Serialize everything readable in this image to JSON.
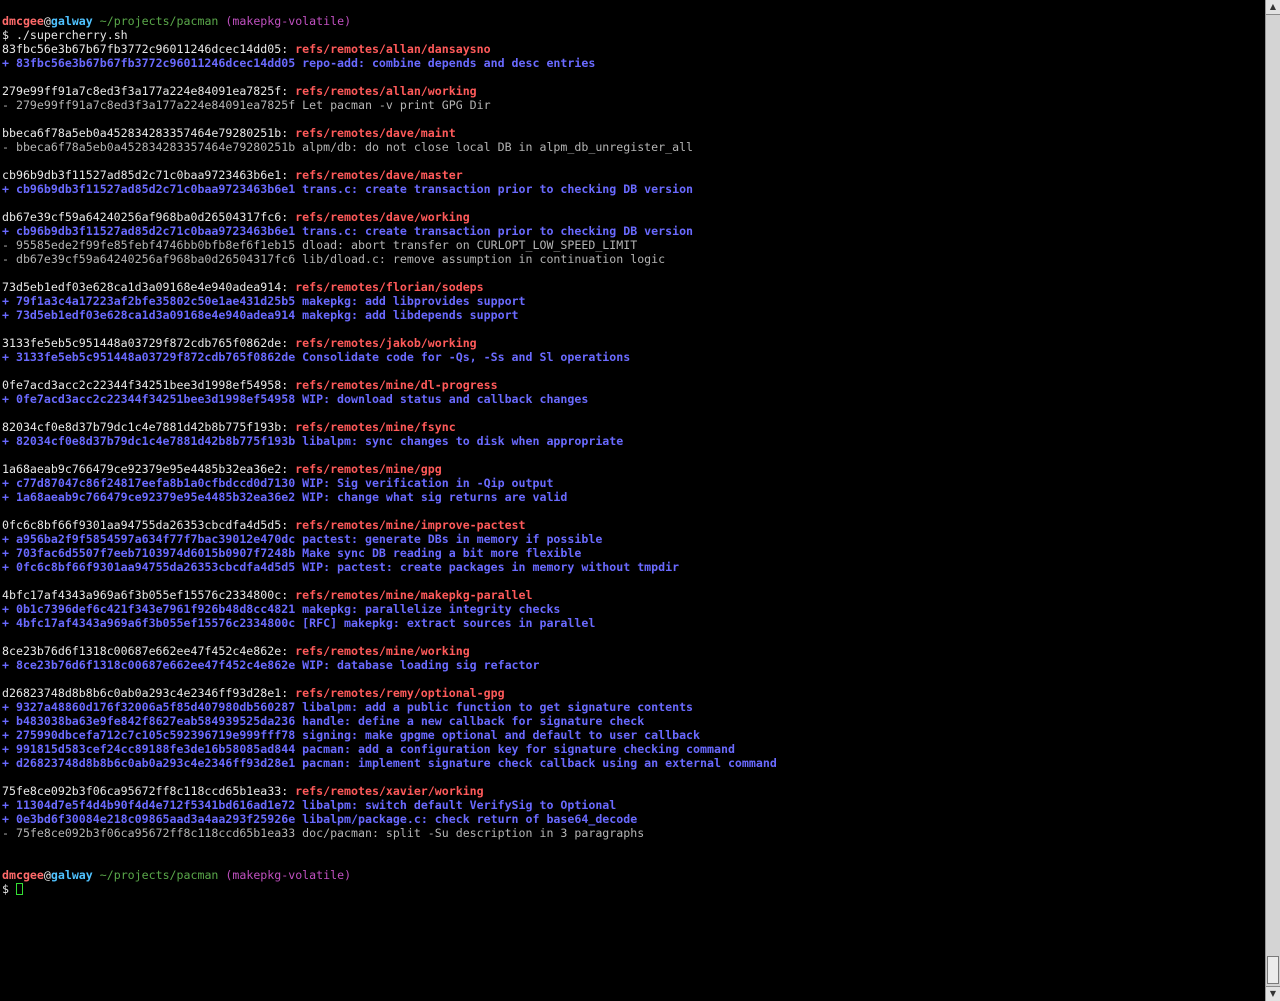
{
  "prompt": {
    "user": "dmcgee",
    "at": "@",
    "host": "galway",
    "path": "~/projects/pacman",
    "branch": "(makepkg-volatile)",
    "symbol": "$",
    "command": "./supercherry.sh"
  },
  "groups": [
    {
      "sha": "83fbc56e3b67b67fb3772c96011246dcec14dd05",
      "ref": "refs/remotes/allan/dansaysno",
      "commits": [
        {
          "sign": "+",
          "sha": "83fbc56e3b67b67fb3772c96011246dcec14dd05",
          "msg": "repo-add: combine depends and desc entries"
        }
      ]
    },
    {
      "sha": "279e99ff91a7c8ed3f3a177a224e84091ea7825f",
      "ref": "refs/remotes/allan/working",
      "commits": [
        {
          "sign": "-",
          "sha": "279e99ff91a7c8ed3f3a177a224e84091ea7825f",
          "msg": "Let pacman -v print GPG Dir"
        }
      ]
    },
    {
      "sha": "bbeca6f78a5eb0a452834283357464e79280251b",
      "ref": "refs/remotes/dave/maint",
      "commits": [
        {
          "sign": "-",
          "sha": "bbeca6f78a5eb0a452834283357464e79280251b",
          "msg": "alpm/db: do not close local DB in alpm_db_unregister_all"
        }
      ]
    },
    {
      "sha": "cb96b9db3f11527ad85d2c71c0baa9723463b6e1",
      "ref": "refs/remotes/dave/master",
      "commits": [
        {
          "sign": "+",
          "sha": "cb96b9db3f11527ad85d2c71c0baa9723463b6e1",
          "msg": "trans.c: create transaction prior to checking DB version"
        }
      ]
    },
    {
      "sha": "db67e39cf59a64240256af968ba0d26504317fc6",
      "ref": "refs/remotes/dave/working",
      "commits": [
        {
          "sign": "+",
          "sha": "cb96b9db3f11527ad85d2c71c0baa9723463b6e1",
          "msg": "trans.c: create transaction prior to checking DB version"
        },
        {
          "sign": "-",
          "sha": "95585ede2f99fe85febf4746bb0bfb8ef6f1eb15",
          "msg": "dload: abort transfer on CURLOPT_LOW_SPEED_LIMIT"
        },
        {
          "sign": "-",
          "sha": "db67e39cf59a64240256af968ba0d26504317fc6",
          "msg": "lib/dload.c: remove assumption in continuation logic"
        }
      ]
    },
    {
      "sha": "73d5eb1edf03e628ca1d3a09168e4e940adea914",
      "ref": "refs/remotes/florian/sodeps",
      "commits": [
        {
          "sign": "+",
          "sha": "79f1a3c4a17223af2bfe35802c50e1ae431d25b5",
          "msg": "makepkg: add libprovides support"
        },
        {
          "sign": "+",
          "sha": "73d5eb1edf03e628ca1d3a09168e4e940adea914",
          "msg": "makepkg: add libdepends support"
        }
      ]
    },
    {
      "sha": "3133fe5eb5c951448a03729f872cdb765f0862de",
      "ref": "refs/remotes/jakob/working",
      "commits": [
        {
          "sign": "+",
          "sha": "3133fe5eb5c951448a03729f872cdb765f0862de",
          "msg": "Consolidate code for -Qs, -Ss and Sl operations"
        }
      ]
    },
    {
      "sha": "0fe7acd3acc2c22344f34251bee3d1998ef54958",
      "ref": "refs/remotes/mine/dl-progress",
      "commits": [
        {
          "sign": "+",
          "sha": "0fe7acd3acc2c22344f34251bee3d1998ef54958",
          "msg": "WIP: download status and callback changes"
        }
      ]
    },
    {
      "sha": "82034cf0e8d37b79dc1c4e7881d42b8b775f193b",
      "ref": "refs/remotes/mine/fsync",
      "commits": [
        {
          "sign": "+",
          "sha": "82034cf0e8d37b79dc1c4e7881d42b8b775f193b",
          "msg": "libalpm: sync changes to disk when appropriate"
        }
      ]
    },
    {
      "sha": "1a68aeab9c766479ce92379e95e4485b32ea36e2",
      "ref": "refs/remotes/mine/gpg",
      "commits": [
        {
          "sign": "+",
          "sha": "c77d87047c86f24817eefa8b1a0cfbdccd0d7130",
          "msg": "WIP: Sig verification in -Qip output"
        },
        {
          "sign": "+",
          "sha": "1a68aeab9c766479ce92379e95e4485b32ea36e2",
          "msg": "WIP: change what sig returns are valid"
        }
      ]
    },
    {
      "sha": "0fc6c8bf66f9301aa94755da26353cbcdfa4d5d5",
      "ref": "refs/remotes/mine/improve-pactest",
      "commits": [
        {
          "sign": "+",
          "sha": "a956ba2f9f5854597a634f77f7bac39012e470dc",
          "msg": "pactest: generate DBs in memory if possible"
        },
        {
          "sign": "+",
          "sha": "703fac6d5507f7eeb7103974d6015b0907f7248b",
          "msg": "Make sync DB reading a bit more flexible"
        },
        {
          "sign": "+",
          "sha": "0fc6c8bf66f9301aa94755da26353cbcdfa4d5d5",
          "msg": "WIP: pactest: create packages in memory without tmpdir"
        }
      ]
    },
    {
      "sha": "4bfc17af4343a969a6f3b055ef15576c2334800c",
      "ref": "refs/remotes/mine/makepkg-parallel",
      "commits": [
        {
          "sign": "+",
          "sha": "0b1c7396def6c421f343e7961f926b48d8cc4821",
          "msg": "makepkg: parallelize integrity checks"
        },
        {
          "sign": "+",
          "sha": "4bfc17af4343a969a6f3b055ef15576c2334800c",
          "msg": "[RFC] makepkg: extract sources in parallel"
        }
      ]
    },
    {
      "sha": "8ce23b76d6f1318c00687e662ee47f452c4e862e",
      "ref": "refs/remotes/mine/working",
      "commits": [
        {
          "sign": "+",
          "sha": "8ce23b76d6f1318c00687e662ee47f452c4e862e",
          "msg": "WIP: database loading sig refactor"
        }
      ]
    },
    {
      "sha": "d26823748d8b8b6c0ab0a293c4e2346ff93d28e1",
      "ref": "refs/remotes/remy/optional-gpg",
      "commits": [
        {
          "sign": "+",
          "sha": "9327a48860d176f32006a5f85d407980db560287",
          "msg": "libalpm: add a public function to get signature contents"
        },
        {
          "sign": "+",
          "sha": "b483038ba63e9fe842f8627eab584939525da236",
          "msg": "handle: define a new callback for signature check"
        },
        {
          "sign": "+",
          "sha": "275990dbcefa712c7c105c592396719e999fff78",
          "msg": "signing: make gpgme optional and default to user callback"
        },
        {
          "sign": "+",
          "sha": "991815d583cef24cc89188fe3de16b58085ad844",
          "msg": "pacman: add a configuration key for signature checking command"
        },
        {
          "sign": "+",
          "sha": "d26823748d8b8b6c0ab0a293c4e2346ff93d28e1",
          "msg": "pacman: implement signature check callback using an external command"
        }
      ]
    },
    {
      "sha": "75fe8ce092b3f06ca95672ff8c118ccd65b1ea33",
      "ref": "refs/remotes/xavier/working",
      "commits": [
        {
          "sign": "+",
          "sha": "11304d7e5f4d4b90f4d4e712f5341bd616ad1e72",
          "msg": "libalpm: switch default VerifySig to Optional"
        },
        {
          "sign": "+",
          "sha": "0e3bd6f30084e218c09865aad3a4aa293f25926e",
          "msg": "libalpm/package.c: check return of base64_decode"
        },
        {
          "sign": "-",
          "sha": "75fe8ce092b3f06ca95672ff8c118ccd65b1ea33",
          "msg": "doc/pacman: split -Su description in 3 paragraphs"
        }
      ]
    }
  ],
  "scrollbar": {
    "up_arrow": "▲",
    "down_arrow": "▼"
  },
  "colors": {
    "background": "#000000",
    "ref": "#ff5a5a",
    "added_commit": "#6a6aff",
    "removed_commit": "#b4b4b4",
    "user": "#ff6a6a",
    "host": "#4fc2ff",
    "path": "#5aa84a",
    "branch": "#c050c0",
    "cursor": "#35e035"
  }
}
